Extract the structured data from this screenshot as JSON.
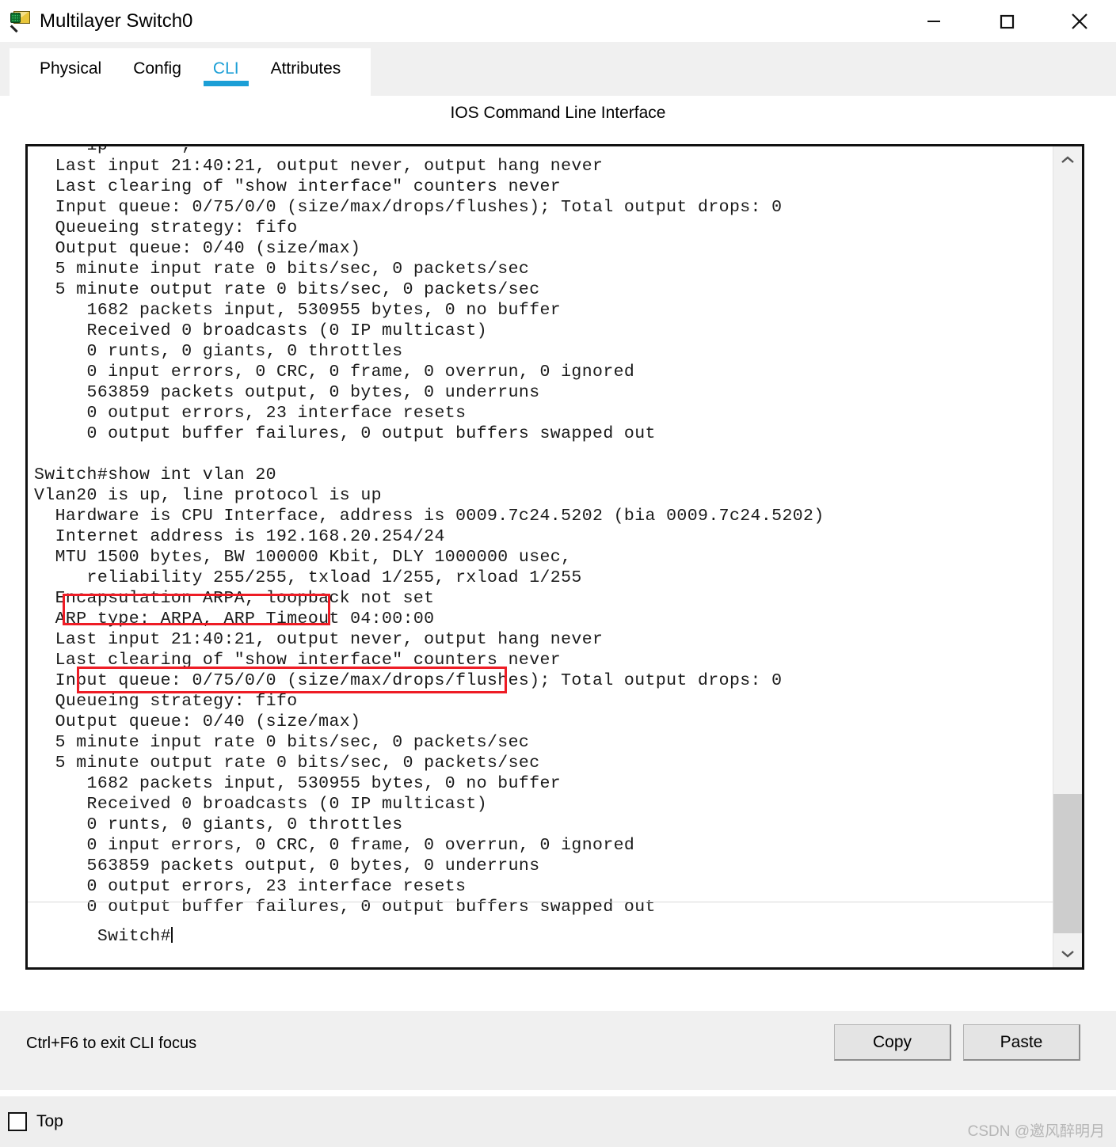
{
  "window": {
    "title": "Multilayer Switch0",
    "icon": "packet-tracer-device-icon",
    "minimize_label": "—",
    "maximize_label": "□",
    "close_label": "✕"
  },
  "tabs": [
    {
      "label": "Physical",
      "active": false
    },
    {
      "label": "Config",
      "active": false
    },
    {
      "label": "CLI",
      "active": true
    },
    {
      "label": "Attributes",
      "active": false
    }
  ],
  "cli": {
    "header": "IOS Command Line Interface",
    "accent_color": "#1c9fd6",
    "highlight_color": "#ee1c25",
    "clipped_top_line": "     ip       ,",
    "output": "  Last input 21:40:21, output never, output hang never\n  Last clearing of \"show interface\" counters never\n  Input queue: 0/75/0/0 (size/max/drops/flushes); Total output drops: 0\n  Queueing strategy: fifo\n  Output queue: 0/40 (size/max)\n  5 minute input rate 0 bits/sec, 0 packets/sec\n  5 minute output rate 0 bits/sec, 0 packets/sec\n     1682 packets input, 530955 bytes, 0 no buffer\n     Received 0 broadcasts (0 IP multicast)\n     0 runts, 0 giants, 0 throttles\n     0 input errors, 0 CRC, 0 frame, 0 overrun, 0 ignored\n     563859 packets output, 0 bytes, 0 underruns\n     0 output errors, 23 interface resets\n     0 output buffer failures, 0 output buffers swapped out\n\nSwitch#show int vlan 20\nVlan20 is up, line protocol is up\n  Hardware is CPU Interface, address is 0009.7c24.5202 (bia 0009.7c24.5202)\n  Internet address is 192.168.20.254/24\n  MTU 1500 bytes, BW 100000 Kbit, DLY 1000000 usec,\n     reliability 255/255, txload 1/255, rxload 1/255\n  Encapsulation ARPA, loopback not set\n  ARP type: ARPA, ARP Timeout 04:00:00\n  Last input 21:40:21, output never, output hang never\n  Last clearing of \"show interface\" counters never\n  Input queue: 0/75/0/0 (size/max/drops/flushes); Total output drops: 0\n  Queueing strategy: fifo\n  Output queue: 0/40 (size/max)\n  5 minute input rate 0 bits/sec, 0 packets/sec\n  5 minute output rate 0 bits/sec, 0 packets/sec\n     1682 packets input, 530955 bytes, 0 no buffer\n     Received 0 broadcasts (0 IP multicast)\n     0 runts, 0 giants, 0 throttles\n     0 input errors, 0 CRC, 0 frame, 0 overrun, 0 ignored\n     563859 packets output, 0 bytes, 0 underruns\n     0 output errors, 23 interface resets\n     0 output buffer failures, 0 output buffers swapped out",
    "prompt": "Switch#",
    "highlights": [
      {
        "name": "command-highlight",
        "text": "Switch#show int vlan 20"
      },
      {
        "name": "ip-address-highlight",
        "text": "Internet address is 192.168.20.254/24"
      }
    ],
    "scrollbar": {
      "up_arrow": "ⱏ",
      "down_arrow": "ⱟ"
    }
  },
  "footer": {
    "focus_hint": "Ctrl+F6 to exit CLI focus",
    "copy_label": "Copy",
    "paste_label": "Paste"
  },
  "bottom": {
    "top_checkbox_label": "Top",
    "top_checkbox_checked": false,
    "watermark": "CSDN @邀风醉明月"
  }
}
